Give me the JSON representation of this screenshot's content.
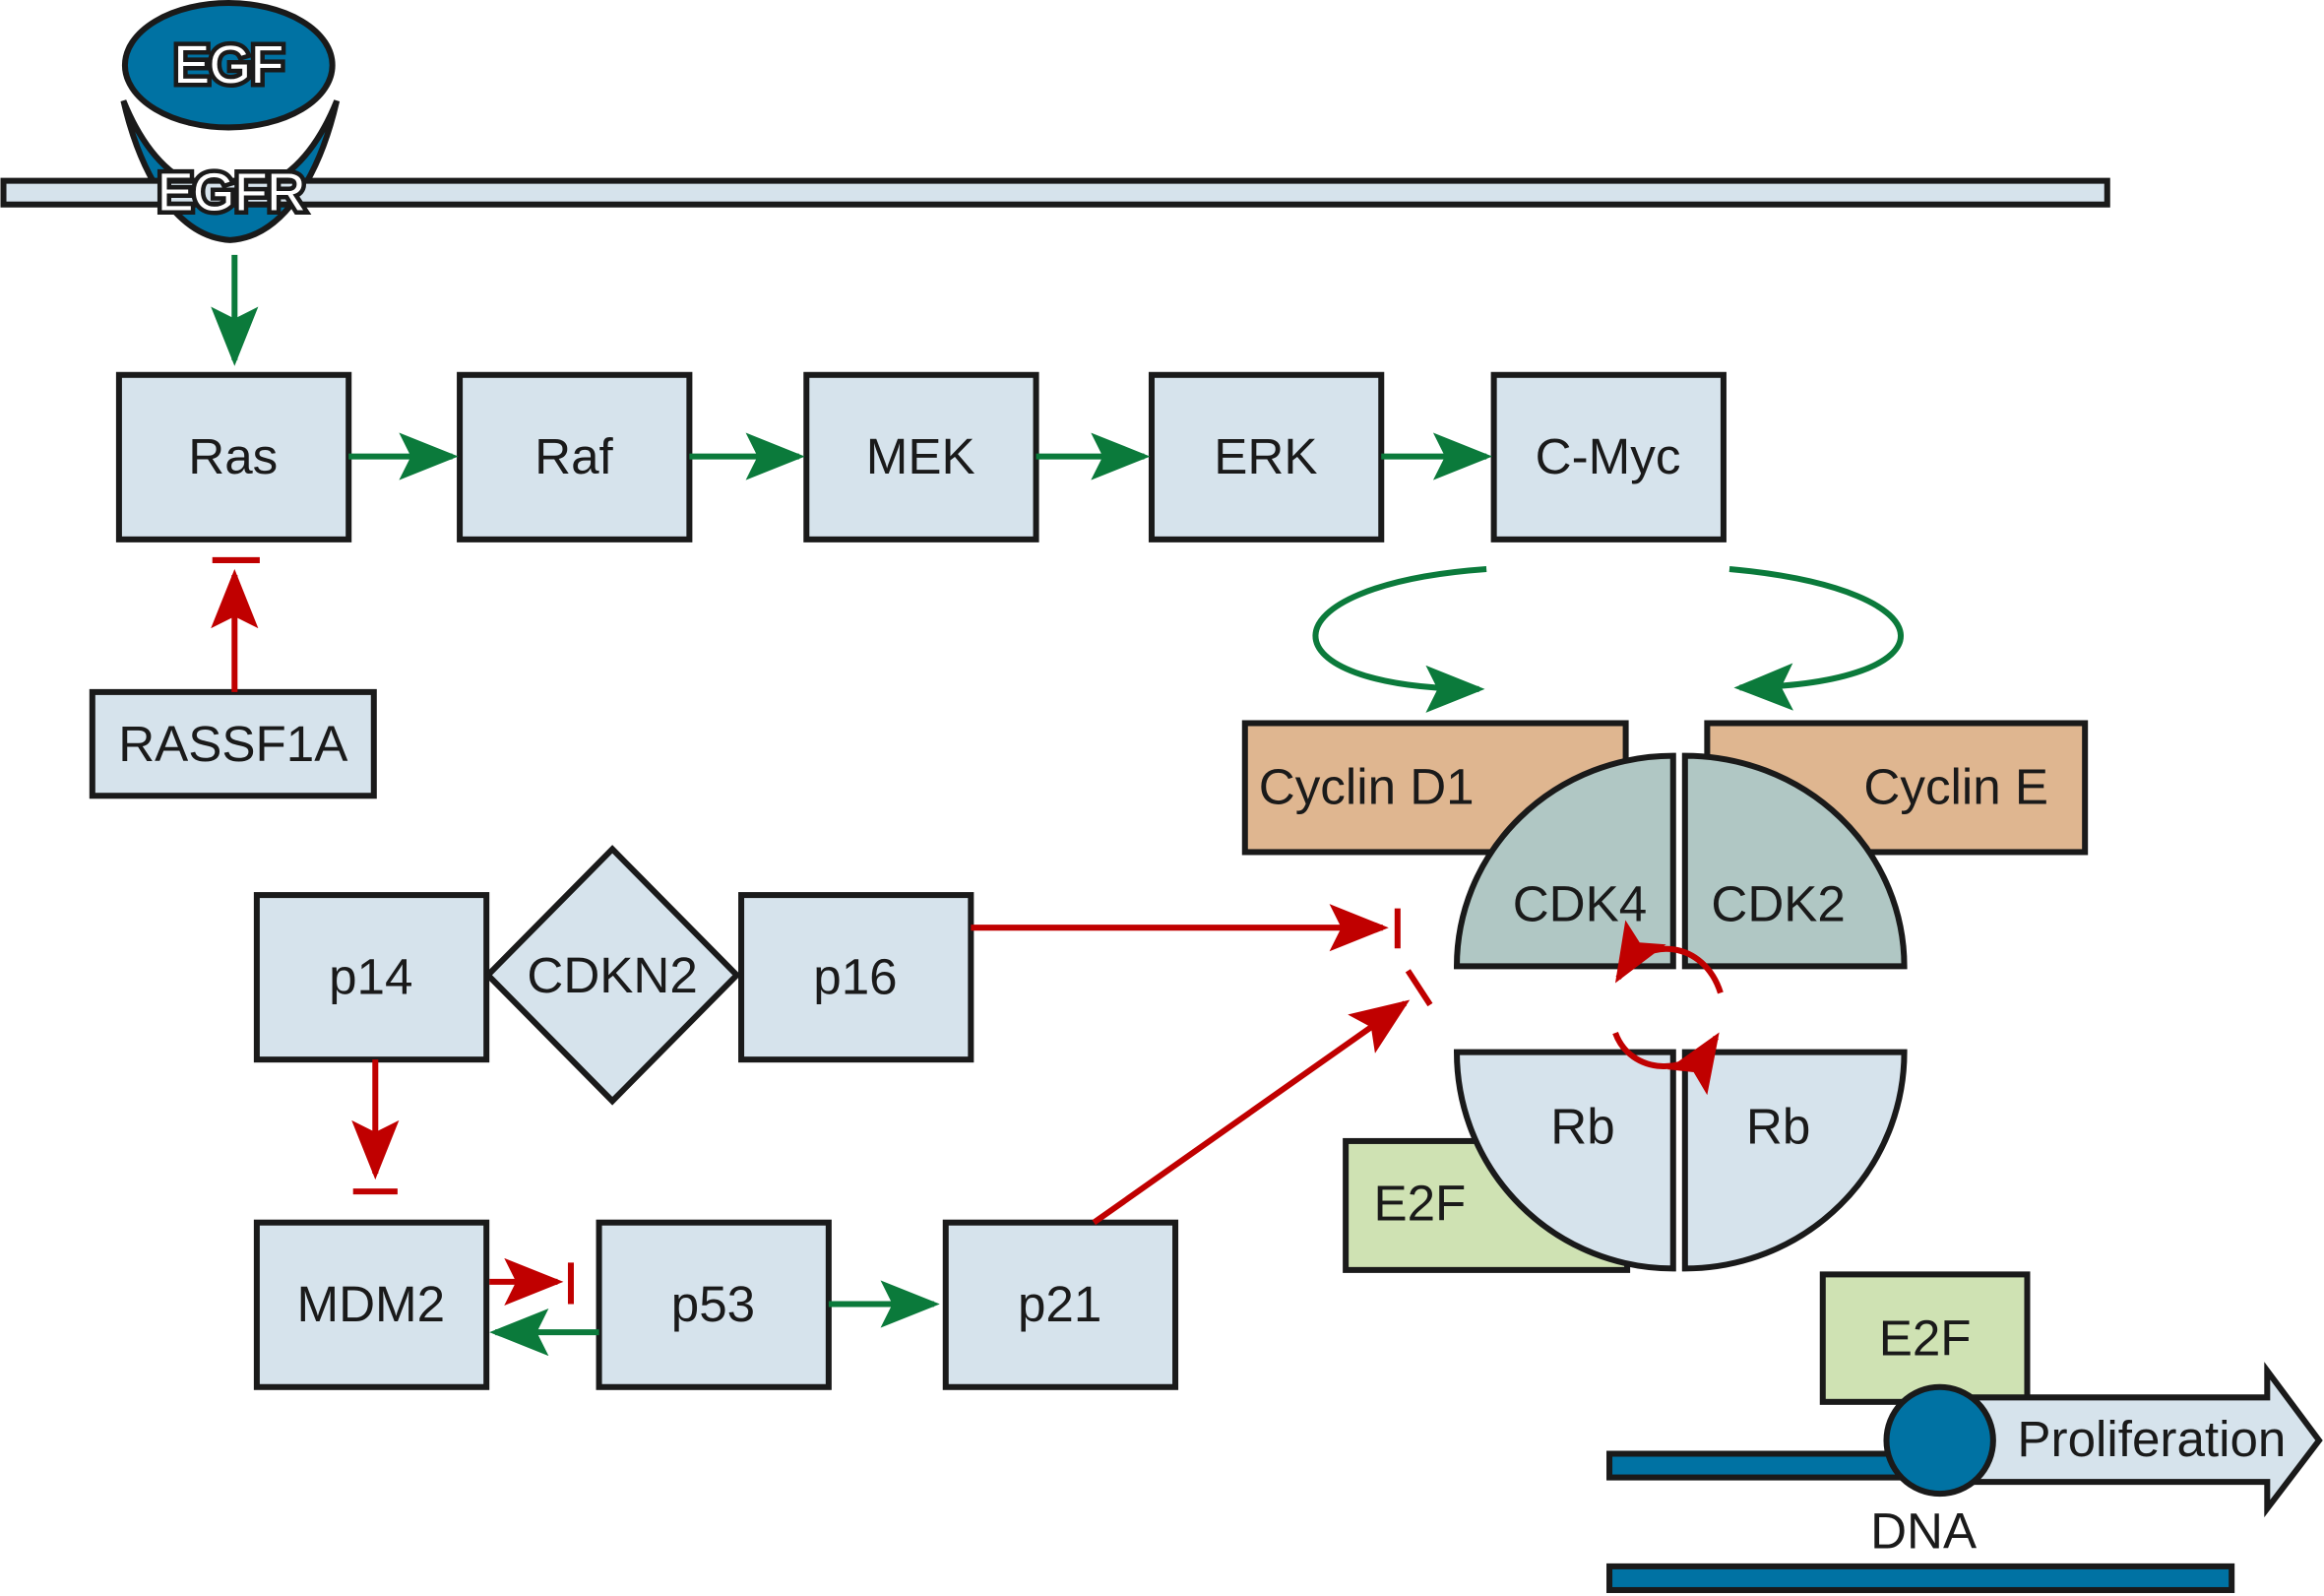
{
  "colors": {
    "box": "#d6e3ec",
    "receptor": "#0072a3",
    "cyclin": "#dfb690",
    "cdk": "#b0c7c4",
    "e2f": "#cfe2b3",
    "activation": "#0b7a3b",
    "inhibition": "#c00000"
  },
  "nodes": {
    "egf": "EGF",
    "egfr": "EGFR",
    "ras": "Ras",
    "raf": "Raf",
    "mek": "MEK",
    "erk": "ERK",
    "cmyc": "C-Myc",
    "rassf1a": "RASSF1A",
    "cyclin_d1": "Cyclin D1",
    "cyclin_e": "Cyclin E",
    "cdk4": "CDK4",
    "cdk2": "CDK2",
    "rb1": "Rb",
    "rb2": "Rb",
    "e2f_bound": "E2F",
    "e2f_free": "E2F",
    "p14": "p14",
    "cdkn2": "CDKN2",
    "p16": "p16",
    "mdm2": "MDM2",
    "p53": "p53",
    "p21": "p21",
    "proliferation": "Proliferation",
    "dna": "DNA"
  }
}
